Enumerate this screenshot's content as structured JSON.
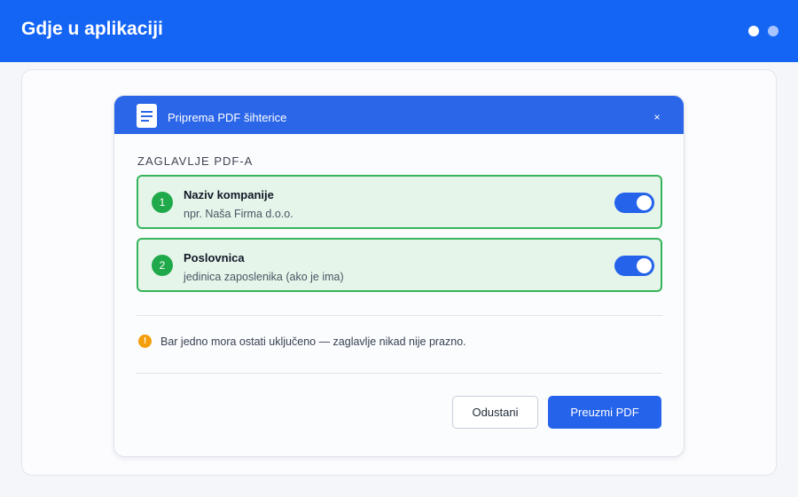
{
  "app": {
    "title": "Gdje u aplikaciji"
  },
  "dialog": {
    "title": "Priprema PDF šihterice",
    "close_label": "×",
    "section_label": "ZAGLAVLJE PDF-A",
    "options": [
      {
        "number": "1",
        "title": "Naziv kompanije",
        "subtitle": "npr. Naša Firma d.o.o.",
        "enabled": true
      },
      {
        "number": "2",
        "title": "Poslovnica",
        "subtitle": "jedinica zaposlenika (ako je ima)",
        "enabled": true
      }
    ],
    "info_icon": "!",
    "info_text": "Bar jedno mora ostati uključeno — zaglavlje nikad nije prazno.",
    "cancel_label": "Odustani",
    "download_label": "Preuzmi PDF"
  },
  "colors": {
    "brand": "#1565f5",
    "dialog_header": "#2b66e8",
    "option_bg": "#e6f5ea",
    "option_border": "#37b45a",
    "badge": "#1fa94a",
    "toggle_on": "#2563eb",
    "warning": "#f59e0b"
  },
  "icons": {
    "window_dots": [
      "dot-active",
      "dot-inactive"
    ],
    "header_icon": "document-icon",
    "close": "close-icon",
    "info": "warning-info-icon"
  }
}
